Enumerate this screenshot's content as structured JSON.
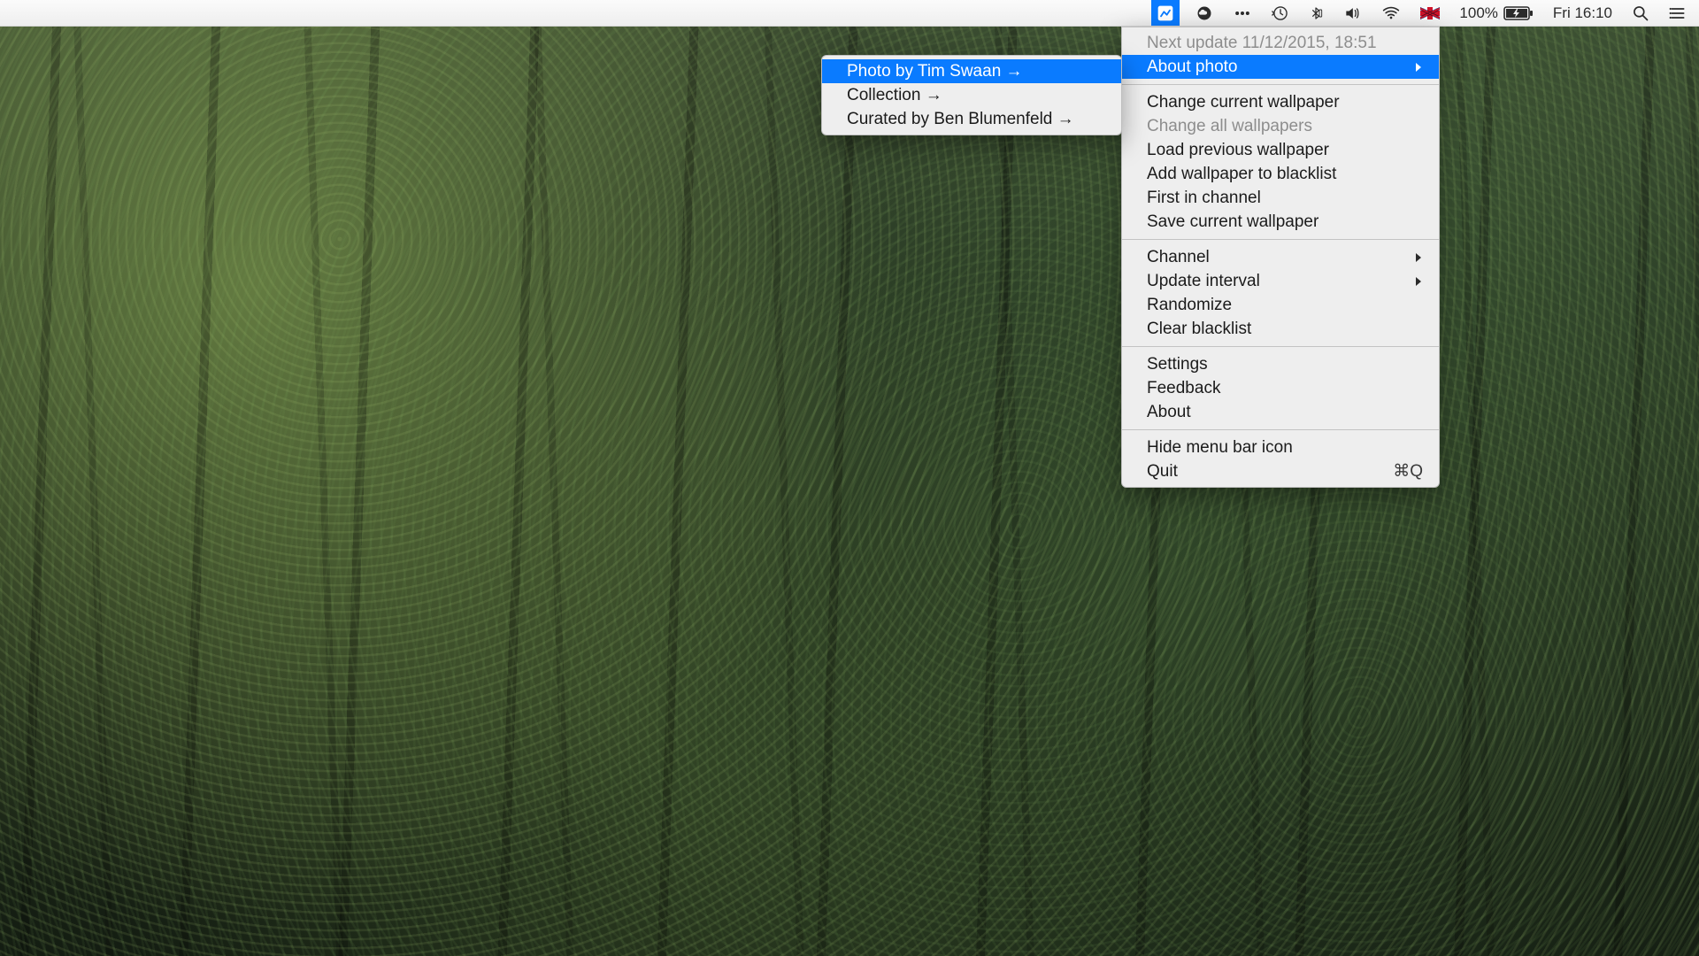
{
  "menubar": {
    "battery_label": "100%",
    "clock_label": "Fri 16:10"
  },
  "main_menu": {
    "next_update": "Next update 11/12/2015, 18:51",
    "about_photo": "About photo",
    "change_current": "Change current wallpaper",
    "change_all": "Change all wallpapers",
    "load_previous": "Load previous wallpaper",
    "add_blacklist": "Add wallpaper to blacklist",
    "first_channel": "First in channel",
    "save_current": "Save current wallpaper",
    "channel": "Channel",
    "update_interval": "Update interval",
    "randomize": "Randomize",
    "clear_blacklist": "Clear blacklist",
    "settings": "Settings",
    "feedback": "Feedback",
    "about": "About",
    "hide_icon": "Hide menu bar icon",
    "quit": "Quit",
    "quit_shortcut": "⌘Q"
  },
  "submenu": {
    "photo_by": "Photo by Tim Swaan →",
    "collection": "Collection →",
    "curated_by": "Curated by Ben Blumenfeld →"
  }
}
